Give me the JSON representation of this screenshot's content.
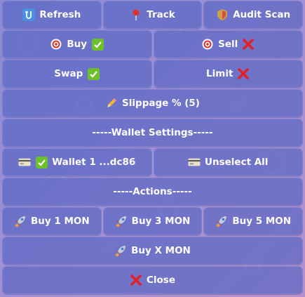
{
  "keyboard": {
    "refresh_label": "Refresh",
    "track_label": "Track",
    "audit_scan_label": "Audit Scan",
    "buy_label": "Buy",
    "sell_label": "Sell",
    "swap_label": "Swap",
    "limit_label": "Limit",
    "slippage_label": "Slippage % (5)",
    "wallet_settings_label": "-----Wallet Settings-----",
    "wallet_label": "Wallet 1 ...dc86",
    "unselect_all_label": "Unselect All",
    "actions_label": "-----Actions-----",
    "buy1_label": "Buy 1 MON",
    "buy3_label": "Buy 3 MON",
    "buy5_label": "Buy 5 MON",
    "buyx_label": "Buy X MON",
    "close_label": "Close"
  },
  "icons": {
    "refresh": "refresh-icon",
    "track": "pin-icon",
    "audit": "shield-icon",
    "target": "target-icon",
    "check": "check-mark-icon",
    "cross": "cross-mark-icon",
    "pencil": "pencil-icon",
    "card": "credit-card-icon",
    "rocket": "rocket-icon"
  },
  "colors": {
    "button_bg": "#5c68c4",
    "check_green": "#6cc02a",
    "cross_red": "#e0202a",
    "text": "#ffffff"
  }
}
